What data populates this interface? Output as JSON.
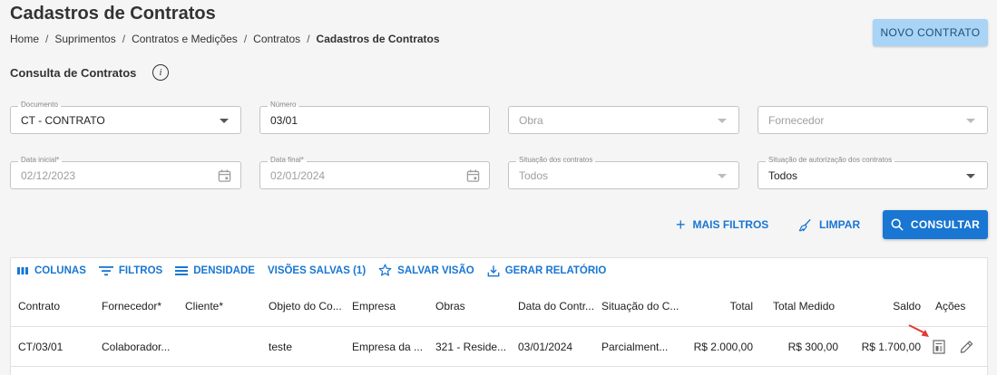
{
  "page": {
    "title": "Cadastros de Contratos",
    "breadcrumb": [
      "Home",
      "Suprimentos",
      "Contratos e Medições",
      "Contratos",
      "Cadastros de Contratos"
    ],
    "new_button": "NOVO CONTRATO"
  },
  "filters": {
    "section_title": "Consulta de Contratos",
    "documento": {
      "label": "Documento",
      "value": "CT - CONTRATO"
    },
    "numero": {
      "label": "Número",
      "value": "03/01"
    },
    "obra": {
      "placeholder": "Obra"
    },
    "fornecedor": {
      "placeholder": "Fornecedor"
    },
    "data_inicial": {
      "label": "Data inicial*",
      "value": "02/12/2023"
    },
    "data_final": {
      "label": "Data final*",
      "value": "02/01/2024"
    },
    "situacao": {
      "label": "Situação dos contratos",
      "value": "Todos"
    },
    "situacao_aut": {
      "label": "Situação de autorização dos contratos",
      "value": "Todos"
    }
  },
  "actions": {
    "mais_filtros": "MAIS FILTROS",
    "limpar": "LIMPAR",
    "consultar": "CONSULTAR"
  },
  "grid": {
    "toolbar": {
      "colunas": "COLUNAS",
      "filtros": "FILTROS",
      "densidade": "DENSIDADE",
      "visoes_salvas": "VISÕES SALVAS (1)",
      "salvar_visao": "SALVAR VISÃO",
      "gerar_relatorio": "GERAR RELATÓRIO"
    },
    "columns": [
      "Contrato",
      "Fornecedor*",
      "Cliente*",
      "Objeto do Co...",
      "Empresa",
      "Obras",
      "Data do Contr...",
      "Situação do C...",
      "Total",
      "Total Medido",
      "Saldo",
      "Ações"
    ],
    "rows": [
      {
        "contrato": "CT/03/01",
        "fornecedor": "Colaborador...",
        "cliente": "",
        "objeto": "teste",
        "empresa": "Empresa da ...",
        "obras": "321 - Reside...",
        "data": "03/01/2024",
        "situacao": "Parcialment...",
        "total": "R$ 2.000,00",
        "total_medido": "R$ 300,00",
        "saldo": "R$ 1.700,00"
      }
    ]
  },
  "colors": {
    "primary": "#1976d2",
    "new_button_bg": "#a9d4f5",
    "annotation_arrow": "#e53935"
  }
}
